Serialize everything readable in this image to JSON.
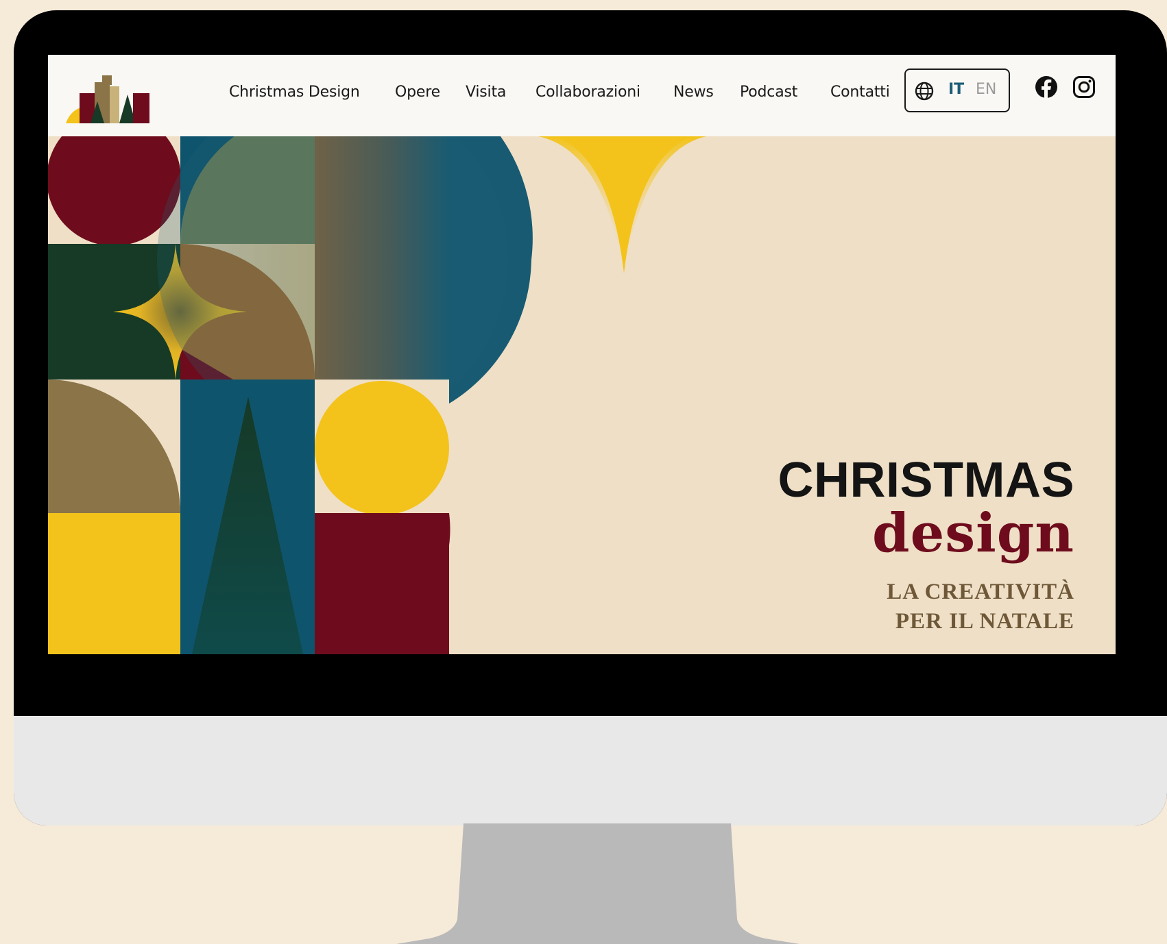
{
  "nav": {
    "items": [
      {
        "label": "Christmas Design"
      },
      {
        "label": "Opere"
      },
      {
        "label": "Visita"
      },
      {
        "label": "Collaborazioni"
      },
      {
        "label": "News"
      },
      {
        "label": "Podcast"
      },
      {
        "label": "Contatti"
      }
    ],
    "language": {
      "current": "IT",
      "other": "EN",
      "icon": "globe-icon"
    },
    "social": [
      {
        "icon": "facebook-icon"
      },
      {
        "icon": "instagram-icon"
      }
    ]
  },
  "hero": {
    "title_line1": "CHRISTMAS",
    "title_line2": "design",
    "subtitle_line1": "LA CREATIVITÀ",
    "subtitle_line2": "PER IL NATALE"
  },
  "colors": {
    "maroon": "#6e0c1d",
    "teal": "#0f546d",
    "dark_green": "#163a26",
    "gold": "#f3c31b",
    "olive": "#8a7448",
    "cream": "#efdfc6",
    "lang_accent": "#1d5d77"
  }
}
